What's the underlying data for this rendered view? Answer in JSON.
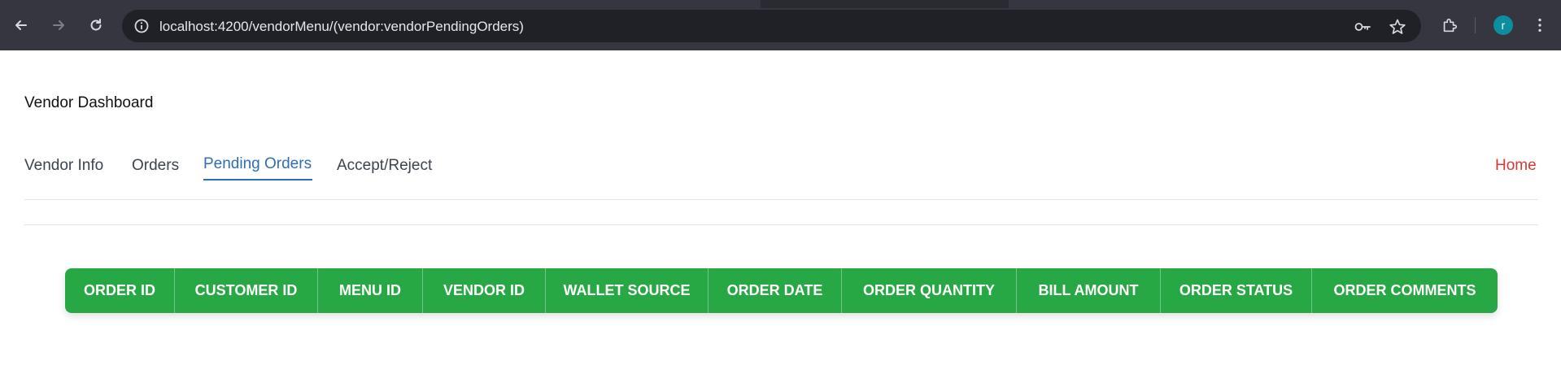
{
  "browser": {
    "url": "localhost:4200/vendorMenu/(vendor:vendorPendingOrders)",
    "avatar_letter": "r",
    "avatar_color": "#0b8ea0"
  },
  "page": {
    "title": "Vendor Dashboard",
    "nav": [
      {
        "label": "Vendor Info",
        "active": false
      },
      {
        "label": "Orders",
        "active": false
      },
      {
        "label": "Pending Orders",
        "active": true
      },
      {
        "label": "Accept/Reject",
        "active": false
      }
    ],
    "home_label": "Home"
  },
  "table": {
    "headers": [
      "ORDER ID",
      "CUSTOMER ID",
      "MENU ID",
      "VENDOR ID",
      "WALLET SOURCE",
      "ORDER DATE",
      "ORDER QUANTITY",
      "BILL AMOUNT",
      "ORDER STATUS",
      "ORDER COMMENTS"
    ],
    "header_color": "#28a745"
  },
  "colors": {
    "active_tab": "#2f6eb5",
    "home_link": "#d93636"
  }
}
